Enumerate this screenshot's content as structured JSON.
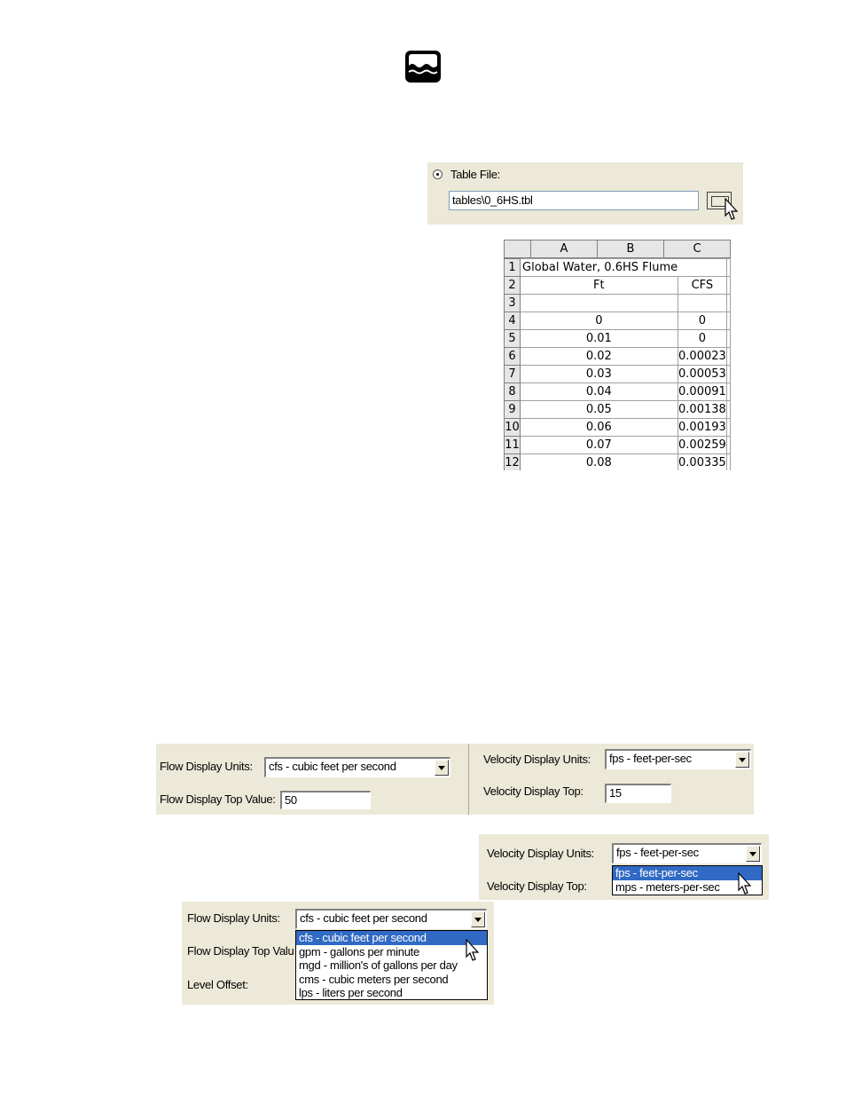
{
  "logo": {
    "icon": "water-waves-icon"
  },
  "table_file_panel": {
    "radio_label": "Table File:",
    "path_value": "tables\\0_6HS.tbl",
    "browse_icon": "browse-button-icon"
  },
  "spreadsheet": {
    "columns": [
      "A",
      "B",
      "C"
    ],
    "rows": [
      {
        "n": "1",
        "a": "Global Water, 0.6HS Flume",
        "b": "",
        "c": ""
      },
      {
        "n": "2",
        "a": "Ft",
        "b": "CFS",
        "c": ""
      },
      {
        "n": "3",
        "a": "",
        "b": "",
        "c": ""
      },
      {
        "n": "4",
        "a": "0",
        "b": "0",
        "c": ""
      },
      {
        "n": "5",
        "a": "0.01",
        "b": "0",
        "c": ""
      },
      {
        "n": "6",
        "a": "0.02",
        "b": "0.00023",
        "c": ""
      },
      {
        "n": "7",
        "a": "0.03",
        "b": "0.00053",
        "c": ""
      },
      {
        "n": "8",
        "a": "0.04",
        "b": "0.00091",
        "c": ""
      },
      {
        "n": "9",
        "a": "0.05",
        "b": "0.00138",
        "c": ""
      },
      {
        "n": "10",
        "a": "0.06",
        "b": "0.00193",
        "c": ""
      },
      {
        "n": "11",
        "a": "0.07",
        "b": "0.00259",
        "c": ""
      },
      {
        "n": "12",
        "a": "0.08",
        "b": "0.00335",
        "c": ""
      }
    ]
  },
  "flow_panel": {
    "units_label": "Flow Display Units:",
    "units_value": "cfs - cubic feet per second",
    "top_label": "Flow Display Top Value:",
    "top_value": "50"
  },
  "velocity_panel": {
    "units_label": "Velocity Display Units:",
    "units_value": "fps - feet-per-sec",
    "top_label": "Velocity Display Top:",
    "top_value": "15"
  },
  "velocity_dropdown": {
    "units_label": "Velocity Display Units:",
    "units_value": "fps - feet-per-sec",
    "top_label": "Velocity Display Top:",
    "options": [
      "fps - feet-per-sec",
      "mps - meters-per-sec"
    ],
    "selected": "fps - feet-per-sec"
  },
  "flow_dropdown": {
    "units_label": "Flow Display Units:",
    "units_value": "cfs - cubic feet per second",
    "top_label": "Flow Display Top Valu",
    "offset_label": "Level Offset:",
    "options": [
      "cfs - cubic feet per second",
      "gpm - gallons per minute",
      "mgd - million's of gallons per day",
      "cms - cubic meters per second",
      "lps - liters per second"
    ],
    "selected": "cfs - cubic feet per second"
  },
  "colors": {
    "panel": "#ece9d8",
    "selection": "#316ac5"
  }
}
